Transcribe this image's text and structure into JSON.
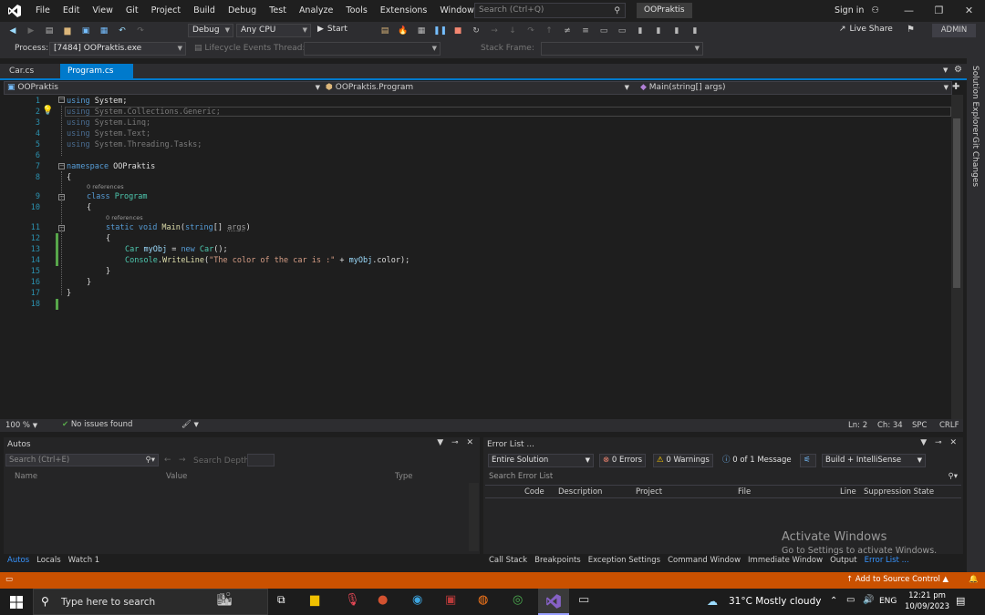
{
  "menubar": {
    "items": [
      "File",
      "Edit",
      "View",
      "Git",
      "Project",
      "Build",
      "Debug",
      "Test",
      "Analyze",
      "Tools",
      "Extensions",
      "Window",
      "Help"
    ],
    "search_placeholder": "Search (Ctrl+Q)",
    "solution_name": "OOPraktis",
    "signin": "Sign in"
  },
  "toolbar": {
    "config": "Debug",
    "platform": "Any CPU",
    "start": "Start",
    "live_share": "Live Share",
    "admin": "ADMIN",
    "process_label": "Process:",
    "process_value": "[7484] OOPraktis.exe",
    "lifecycle": "Lifecycle Events",
    "thread": "Thread:",
    "stack_frame": "Stack Frame:"
  },
  "tabs": {
    "car": "Car.cs",
    "program": "Program.cs"
  },
  "navbar": {
    "project": "OOPraktis",
    "class": "OOPraktis.Program",
    "member": "Main(string[] args)"
  },
  "code": {
    "numbers": [
      "1",
      "2",
      "3",
      "4",
      "5",
      "6",
      "7",
      "8",
      "9",
      "10",
      "11",
      "12",
      "13",
      "14",
      "15",
      "16",
      "17",
      "18"
    ],
    "l1a": "using",
    "l1b": " System;",
    "l2a": "using",
    "l2b": " System.Collections.Generic;",
    "l3a": "using",
    "l3b": " System.Linq;",
    "l4a": "using",
    "l4b": " System.Text;",
    "l5a": "using",
    "l5b": " System.Threading.Tasks;",
    "l7a": "namespace",
    "l7b": " OOPraktis",
    "l8": "{",
    "lens9": "0 references",
    "l9a": "class",
    "l9b": " Program",
    "l10": "{",
    "lens11": "0 references",
    "l11a": "static",
    "l11b": " void",
    "l11c": " Main",
    "l11d": "(",
    "l11e": "string",
    "l11f": "[] ",
    "l11g": "args",
    "l11h": ")",
    "l12": "{",
    "l13a": "Car",
    "l13b": " myObj",
    "l13c": " = ",
    "l13d": "new",
    "l13e": " Car",
    "l13f": "();",
    "l14a": "Console",
    "l14b": ".",
    "l14c": "WriteLine",
    "l14d": "(",
    "l14e": "\"The color of the car is :\"",
    "l14f": " + ",
    "l14g": "myObj",
    "l14h": ".color);",
    "l15": "}",
    "l16": "}",
    "l17": "}"
  },
  "editor_status": {
    "zoom": "100 %",
    "issues": "No issues found",
    "ln": "Ln: 2",
    "ch": "Ch: 34",
    "spc": "SPC",
    "crlf": "CRLF"
  },
  "autos": {
    "title": "Autos",
    "search_placeholder": "Search (Ctrl+E)",
    "search_depth": "Search Depth:",
    "col_name": "Name",
    "col_value": "Value",
    "col_type": "Type",
    "tabs": [
      "Autos",
      "Locals",
      "Watch 1"
    ]
  },
  "errors": {
    "title": "Error List ...",
    "scope": "Entire Solution",
    "errors": "0 Errors",
    "warnings": "0 Warnings",
    "messages": "0 of 1 Message",
    "build": "Build + IntelliSense",
    "search": "Search Error List",
    "cols": [
      "Code",
      "Description",
      "Project",
      "File",
      "Line",
      "Suppression State"
    ],
    "tabs": [
      "Call Stack",
      "Breakpoints",
      "Exception Settings",
      "Command Window",
      "Immediate Window",
      "Output",
      "Error List ..."
    ]
  },
  "watermark": {
    "line1": "Activate Windows",
    "line2": "Go to Settings to activate Windows."
  },
  "statusbar": {
    "add_source": "Add to Source Control"
  },
  "sidebar": {
    "solution_explorer": "Solution Explorer",
    "git_changes": "Git Changes"
  },
  "taskbar": {
    "search": "Type here to search",
    "weather": "31°C  Mostly cloudy",
    "lang": "ENG",
    "time": "12:21 pm",
    "date": "10/09/2023"
  },
  "colors": {
    "accent": "#007acc",
    "statusbar": "#ca5100",
    "vs_purple": "#8661c5"
  }
}
